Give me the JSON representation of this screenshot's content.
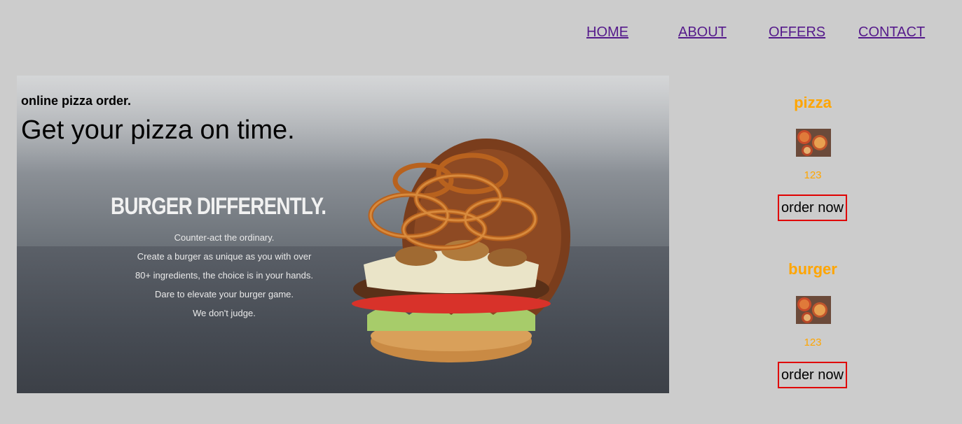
{
  "nav": {
    "items": [
      {
        "label": "HOME"
      },
      {
        "label": "ABOUT"
      },
      {
        "label": "OFFERS"
      },
      {
        "label": "CONTACT"
      }
    ]
  },
  "hero": {
    "kicker": "online pizza order.",
    "headline": "Get your pizza on time.",
    "promo": {
      "title": "BURGER DIFFERENTLY.",
      "lines": [
        "Counter-act the ordinary.",
        "Create a burger as unique as you with over",
        "80+ ingredients, the choice is in your hands.",
        "Dare to elevate your burger game.",
        "We don't judge."
      ]
    }
  },
  "products": [
    {
      "name": "pizza",
      "price": "123",
      "button": "order now"
    },
    {
      "name": "burger",
      "price": "123",
      "button": "order now"
    }
  ],
  "colors": {
    "background": "#cccccc",
    "link": "#551a8b",
    "accent": "#ffa500",
    "button_border": "#e00000"
  }
}
